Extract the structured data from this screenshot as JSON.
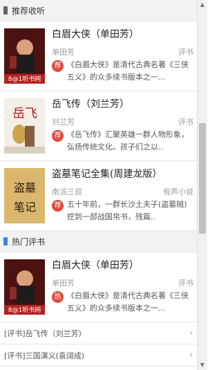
{
  "colors": {
    "recommend_accent": "#666666",
    "hot_accent": "#3a86d6",
    "badge_red": "#e04a3b"
  },
  "recommend": {
    "title": "推荐收听",
    "items": [
      {
        "name": "白眉大侠（单田芳）",
        "author": "单田芳",
        "category": "评书",
        "badge": "荐",
        "desc": "《白眉大侠》是清代古典名著《三侠五义》的众多续书版本之一..."
      },
      {
        "name": "岳飞传（刘兰芳）",
        "author": "刘兰芳",
        "category": "评书",
        "badge": "荐",
        "desc": "《岳飞传》汇聚英雄一群人物形象，弘扬传统文化。孩子们之以.."
      },
      {
        "name": "盗墓笔记全集(周建龙版）",
        "author": "南派三叔",
        "category": "有声小说",
        "badge": "荐",
        "desc": "五十年前，一群长沙土夫子(盗墓贼)挖到一部战国帛书，残篇.."
      }
    ]
  },
  "hot": {
    "title": "热门评书",
    "items": [
      {
        "name": "白眉大侠（单田芳）",
        "author": "单田芳",
        "category": "评书",
        "badge": "热",
        "desc": "《白眉大侠》是清代古典名著《三侠五义》的众多续书版本之一..."
      }
    ],
    "links": [
      {
        "label": "[评书]岳飞传（刘兰芳）"
      },
      {
        "label": "[评书]三国演义(袁阔成)"
      }
    ]
  },
  "covers": {
    "cover1": {
      "stamp": "8@1听书网"
    },
    "cover2": {
      "calligraphy": "岳飞"
    },
    "cover3": {
      "calligraphy": "盗墓笔记"
    }
  },
  "icons": {
    "chevron": "chevron-right-icon",
    "scroll_up": "scroll-up-icon",
    "scroll_down": "scroll-down-icon"
  }
}
